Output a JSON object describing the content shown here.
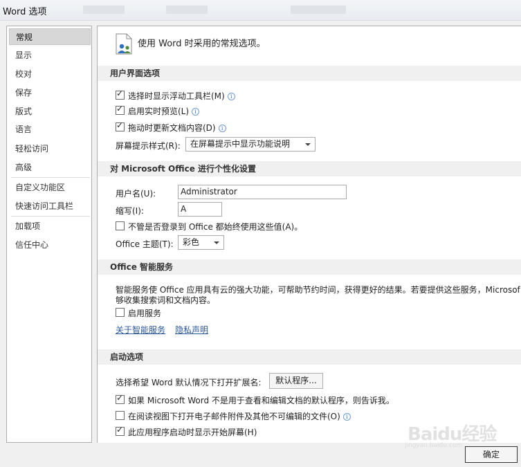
{
  "window": {
    "title": "Word 选项"
  },
  "sidebar": {
    "items": [
      {
        "label": "常规",
        "selected": true
      },
      {
        "label": "显示"
      },
      {
        "label": "校对"
      },
      {
        "label": "保存"
      },
      {
        "label": "版式"
      },
      {
        "label": "语言"
      },
      {
        "label": "轻松访问"
      },
      {
        "label": "高级"
      },
      {
        "label": "自定义功能区"
      },
      {
        "label": "快速访问工具栏"
      },
      {
        "label": "加载项"
      },
      {
        "label": "信任中心"
      }
    ]
  },
  "main": {
    "heading": "使用 Word 时采用的常规选项。",
    "ui_section": {
      "title": "用户界面选项",
      "options": [
        {
          "label": "选择时显示浮动工具栏(M)",
          "checked": true
        },
        {
          "label": "启用实时预览(L)",
          "checked": true
        },
        {
          "label": "拖动时更新文档内容(D)",
          "checked": true
        }
      ],
      "screentip_label": "屏幕提示样式(R):",
      "screentip_value": "在屏幕提示中显示功能说明"
    },
    "personalize_section": {
      "title": "对 Microsoft Office 进行个性化设置",
      "username_label": "用户名(U):",
      "username_value": "Administrator",
      "initials_label": "缩写(I):",
      "initials_value": "A",
      "always_use_label": "不管是否登录到 Office 都始终使用这些值(A)。",
      "always_use_checked": false,
      "theme_label": "Office 主题(T):",
      "theme_value": "彩色"
    },
    "intelligent_section": {
      "title": "Office 智能服务",
      "description_line1": "智能服务使 Office 应用具有云的强大功能，可帮助节约时间，获得更好的结果。若要提供这些服务，Microsof",
      "description_line2": "够收集搜索词和文档内容。",
      "enable_label": "启用服务",
      "enable_checked": false,
      "link_about": "关于智能服务",
      "link_privacy": "隐私声明"
    },
    "startup_section": {
      "title": "启动选项",
      "ext_label": "选择希望 Word 默认情况下打开扩展名:",
      "default_programs_button": "默认程序...",
      "options": [
        {
          "label": "如果 Microsoft Word 不是用于查看和编辑文档的默认程序，则告诉我。",
          "checked": true
        },
        {
          "label": "在阅读视图下打开电子邮件附件及其他不可编辑的文件(O)",
          "checked": false
        },
        {
          "label": "此应用程序启动时显示开始屏幕(H)",
          "checked": true
        }
      ]
    }
  },
  "footer": {
    "ok_button": "确定"
  },
  "watermark": {
    "text": "Baidu经验",
    "sub": "jingyan.baidu.com"
  }
}
